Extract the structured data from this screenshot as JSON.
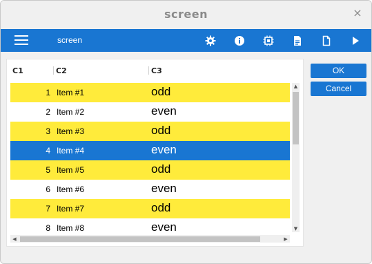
{
  "window": {
    "title": "screen",
    "close_glyph": "×"
  },
  "toolbar": {
    "title": "screen",
    "icons": [
      "gear-icon",
      "info-icon",
      "chip-icon",
      "document-icon",
      "file-icon",
      "play-icon"
    ]
  },
  "table": {
    "columns": [
      "C1",
      "C2",
      "C3"
    ],
    "rows": [
      {
        "c1": "1",
        "c2": "Item #1",
        "c3": "odd",
        "style": "odd"
      },
      {
        "c1": "2",
        "c2": "Item #2",
        "c3": "even",
        "style": "even"
      },
      {
        "c1": "3",
        "c2": "Item #3",
        "c3": "odd",
        "style": "odd"
      },
      {
        "c1": "4",
        "c2": "Item #4",
        "c3": "even",
        "style": "selected"
      },
      {
        "c1": "5",
        "c2": "Item #5",
        "c3": "odd",
        "style": "odd"
      },
      {
        "c1": "6",
        "c2": "Item #6",
        "c3": "even",
        "style": "even"
      },
      {
        "c1": "7",
        "c2": "Item #7",
        "c3": "odd",
        "style": "odd"
      },
      {
        "c1": "8",
        "c2": "Item #8",
        "c3": "even",
        "style": "even"
      }
    ]
  },
  "buttons": {
    "ok": "OK",
    "cancel": "Cancel"
  },
  "colors": {
    "accent": "#1976d2",
    "odd_row": "#ffeb3b"
  }
}
